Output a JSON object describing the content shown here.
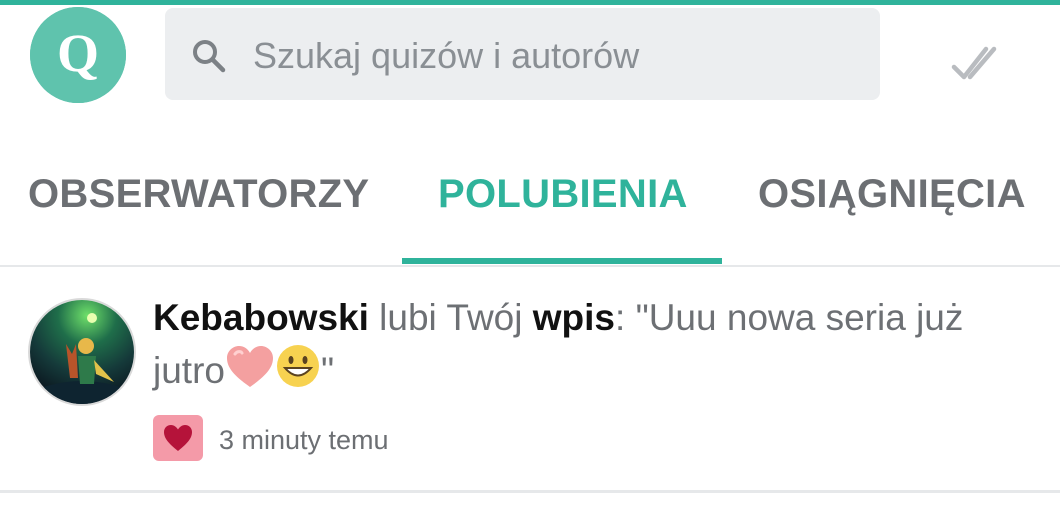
{
  "colors": {
    "accent": "#2fb39b",
    "logo": "#5fc3ad",
    "search_bg": "#eceef0",
    "like_badge": "#f49aa8",
    "heart": "#b5133a"
  },
  "header": {
    "logo_letter": "Q",
    "search": {
      "placeholder": "Szukaj quizów i autorów",
      "icon": "search-icon"
    },
    "action_icon": "double-check-icon"
  },
  "tabs": [
    {
      "label": "OBSERWATORZY",
      "active": false
    },
    {
      "label": "POLUBIENIA",
      "active": true
    },
    {
      "label": "OSIĄGNIĘCIA",
      "active": false
    }
  ],
  "notifications": [
    {
      "user": "Kebabowski",
      "action": " lubi Twój ",
      "object": "wpis",
      "colon": ": ",
      "quote": "\"Uuu nowa seria już jutro",
      "emojis": [
        "heart-emoji",
        "grinning-face-emoji"
      ],
      "quote_end": "\"",
      "badge_icon": "heart-icon",
      "time": "3 minuty temu"
    }
  ]
}
